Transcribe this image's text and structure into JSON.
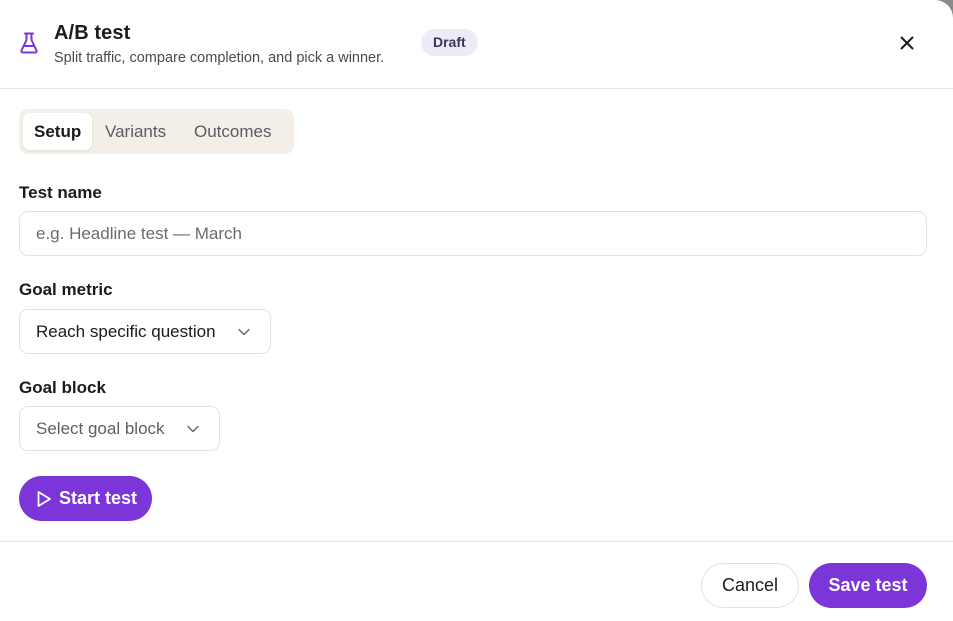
{
  "header": {
    "title": "A/B test",
    "subtitle": "Split traffic, compare completion, and pick a winner.",
    "badge": "Draft",
    "icon": "flask-icon",
    "close_icon": "close-icon"
  },
  "tabs": [
    {
      "label": "Setup",
      "active": true
    },
    {
      "label": "Variants",
      "active": false
    },
    {
      "label": "Outcomes",
      "active": false
    }
  ],
  "form": {
    "test_name": {
      "label": "Test name",
      "value": "",
      "placeholder": "e.g. Headline test — March"
    },
    "goal_metric": {
      "label": "Goal metric",
      "value": "Reach specific question"
    },
    "goal_block": {
      "label": "Goal block",
      "placeholder": "Select goal block"
    }
  },
  "actions": {
    "start_label": "Start test",
    "cancel_label": "Cancel",
    "save_label": "Save test"
  },
  "colors": {
    "accent": "#7b35d8",
    "badge_bg": "#efeaf7",
    "tabs_bg": "#f3efe7"
  }
}
